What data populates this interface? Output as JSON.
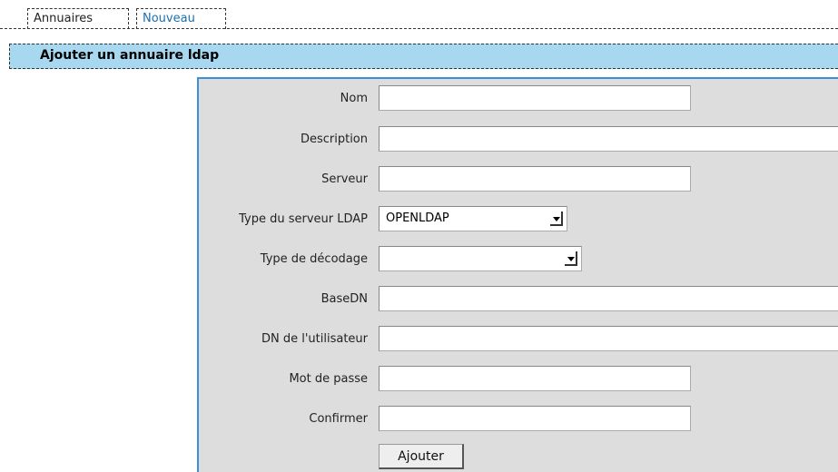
{
  "tabs": [
    {
      "label": "Annuaires"
    },
    {
      "label": "Nouveau"
    }
  ],
  "section": {
    "title": "Ajouter un annuaire ldap"
  },
  "form": {
    "fields": {
      "nom": {
        "label": "Nom",
        "value": ""
      },
      "description": {
        "label": "Description",
        "value": ""
      },
      "serveur": {
        "label": "Serveur",
        "value": ""
      },
      "type_serveur": {
        "label": "Type du serveur LDAP",
        "value": "OPENLDAP"
      },
      "type_decodage": {
        "label": "Type de décodage",
        "value": ""
      },
      "basedn": {
        "label": "BaseDN",
        "value": ""
      },
      "dn_utilisateur": {
        "label": "DN de l'utilisateur",
        "value": ""
      },
      "mot_de_passe": {
        "label": "Mot de passe",
        "value": ""
      },
      "confirmer": {
        "label": "Confirmer",
        "value": ""
      }
    },
    "submit_label": "Ajouter"
  },
  "colors": {
    "accent": "#3d8fd8",
    "header_bg": "#a8d8f0",
    "panel_bg": "#dddddd",
    "link": "#1a6fb0"
  }
}
